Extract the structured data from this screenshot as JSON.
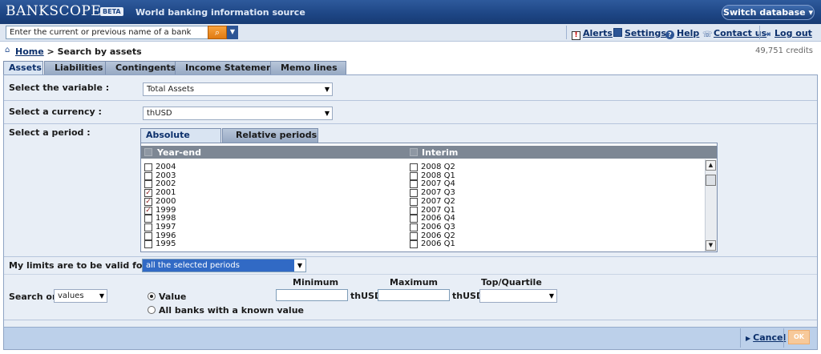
{
  "brand": {
    "name": "BANKSCOPE",
    "badge": "BETA",
    "tagline": "World banking information source"
  },
  "header": {
    "switch_database": "Switch database"
  },
  "search": {
    "value": "Enter the current or previous name of a bank"
  },
  "toplinks": {
    "alerts": "Alerts",
    "settings": "Settings",
    "help": "Help",
    "contact": "Contact us",
    "logout": "Log out"
  },
  "breadcrumb": {
    "home": "Home",
    "current": "> Search by assets"
  },
  "credits": "49,751 credits",
  "tabs": [
    "Assets",
    "Liabilities",
    "Contingents",
    "Income Statement",
    "Memo lines"
  ],
  "form": {
    "variable_label": "Select the variable :",
    "variable_value": "Total Assets",
    "currency_label": "Select a currency :",
    "currency_value": "thUSD",
    "period_label": "Select a period :",
    "period_tabs": [
      "Absolute periods",
      "Relative periods"
    ],
    "columns": [
      "Year-end",
      "Interim"
    ],
    "year_end": [
      {
        "label": "2004",
        "checked": false
      },
      {
        "label": "2003",
        "checked": false
      },
      {
        "label": "2002",
        "checked": false
      },
      {
        "label": "2001",
        "checked": true
      },
      {
        "label": "2000",
        "checked": true
      },
      {
        "label": "1999",
        "checked": true
      },
      {
        "label": "1998",
        "checked": false
      },
      {
        "label": "1997",
        "checked": false
      },
      {
        "label": "1996",
        "checked": false
      },
      {
        "label": "1995",
        "checked": false
      }
    ],
    "interim": [
      {
        "label": "2008 Q2",
        "checked": false
      },
      {
        "label": "2008 Q1",
        "checked": false
      },
      {
        "label": "2007 Q4",
        "checked": false
      },
      {
        "label": "2007 Q3",
        "checked": false
      },
      {
        "label": "2007 Q2",
        "checked": false
      },
      {
        "label": "2007 Q1",
        "checked": false
      },
      {
        "label": "2006 Q4",
        "checked": false
      },
      {
        "label": "2006 Q3",
        "checked": false
      },
      {
        "label": "2006 Q2",
        "checked": false
      },
      {
        "label": "2006 Q1",
        "checked": false
      }
    ],
    "limits_label": "My limits are to be valid for",
    "limits_value": "all the selected periods",
    "search_on_label": "Search on",
    "search_on_value": "values",
    "minimum": "Minimum",
    "maximum": "Maximum",
    "top_quartile": "Top/Quartile",
    "unit": "thUSD",
    "radio_value": "Value",
    "radio_all": "All banks with a known value"
  },
  "footer": {
    "cancel": "Cancel",
    "ok": "OK"
  },
  "icons": [
    "search-icon",
    "dropdown-icon",
    "alert-icon",
    "settings-icon",
    "help-icon",
    "contact-icon",
    "logout-icon",
    "home-icon"
  ]
}
